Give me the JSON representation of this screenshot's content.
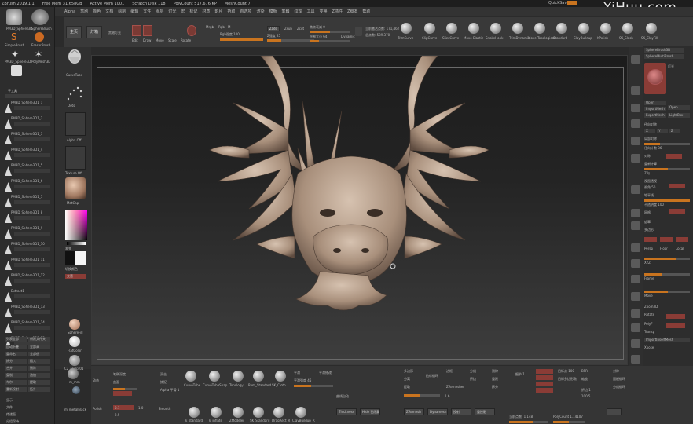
{
  "window": {
    "title_items": [
      "ZBrush 2019.1.1",
      "Free Mem 31.658GB",
      "Active Mem 1001",
      "Scratch Disk 118",
      "PolyCount 517.676 KP",
      "MeshCount 7"
    ],
    "quicksave": "QuickSave",
    "watermark": "YiHuu.com"
  },
  "menu": [
    "Alpha",
    "笔刷",
    "颜色",
    "文档",
    "绘制",
    "编辑",
    "文件",
    "图层",
    "灯光",
    "宏",
    "标记",
    "材质",
    "影片",
    "拾取",
    "首选项",
    "渲染",
    "模板",
    "笔触",
    "纹理",
    "工具",
    "变换",
    "Z插件",
    "Z脚本",
    "帮助"
  ],
  "shelf": {
    "home": "主页",
    "lightbox": "灯箱",
    "preview": "黑暗灯光",
    "edit": "Edit",
    "draw": "Draw",
    "move": "Move",
    "scale": "Scale",
    "rotate": "Rotate",
    "mrgb": "Mrgb",
    "rgb": "Rgb",
    "m": "M",
    "zadd": "Zadd",
    "zsub": "Zsub",
    "zcut": "Zcut",
    "rgb_intensity": "Rgb强度 100",
    "z_intensity": "Z强度 25",
    "focal_shift": "焦点衰减 0",
    "draw_size": "绘制大小 64",
    "dynamic": "Dynamic",
    "active_points": "当前激活点数: 171,462",
    "total_points": "总点数: 589,370",
    "brushes": [
      "TrimCurve",
      "ClipCurve",
      "SliceCurve",
      "Move Elastic",
      "SnakeHook",
      "TrimDynamic",
      "Move Topological",
      "Standard",
      "ClayBuildup",
      "hPolish",
      "SK_Slash",
      "SK_ClayFill"
    ]
  },
  "left_palette": {
    "top_brushes": [
      "PM3D_Sphere3D",
      "SphereBrush",
      "SimpleBrush",
      "EraserBrush",
      "PM3D_Sphere3D",
      "PolyMesh3D"
    ],
    "subtool_header": "子工具",
    "subtools": [
      "PM3D_Sphere3D1_1",
      "PM3D_Sphere3D1_2",
      "PM3D_Sphere3D1_3",
      "PM3D_Sphere3D1_4",
      "PM3D_Sphere3D1_5",
      "PM3D_Sphere3D1_6",
      "PM3D_Sphere3D1_7",
      "PM3D_Sphere3D1_8",
      "PM3D_Sphere3D1_9",
      "PM3D_Sphere3D1_10",
      "PM3D_Sphere3D1_11",
      "PM3D_Sphere3D1_12",
      "Extract1",
      "PM3D_Sphere3D1_13",
      "PM3D_Sphere3D1_14",
      "PM3D_Sphere3D1_15"
    ],
    "bottom_buttons": [
      "列表全部",
      "新建文件夹",
      "自动折叠",
      "全部高",
      "重命名",
      "全部低",
      "拆分",
      "插入",
      "合并",
      "删除",
      "复制",
      "追加",
      "布尔",
      "提取",
      "重新投射",
      "拓扑"
    ],
    "sub_bottom": [
      "显示",
      "文件",
      "传递面",
      "分组保持"
    ]
  },
  "left_col2": {
    "curve_tube": "CurveTube",
    "dots": "Dots",
    "alpha_off": "Alpha Off",
    "texture_off": "Texture Off",
    "matcap": "MatCap",
    "gradient": "渐变",
    "switch_color": "切换颜色",
    "alternate": "交替",
    "sphere_fill": "SphereFill",
    "flat_color": "FlatColor",
    "c2_sculpt": "C2_sculpt01",
    "mh_mm": "m_mm",
    "mm_metal": "m_metalblack"
  },
  "right_palette": {
    "tabs": [
      "SphereBrush3D",
      "SphereMultiBrush"
    ],
    "sections": [
      "灯光",
      "影子",
      "Ambient",
      "LightCap",
      "预设",
      "颜色",
      "位置",
      "强度",
      "背景",
      "渲染"
    ],
    "labels": [
      "Open",
      "LightBox",
      "径向对称",
      "X",
      "Y",
      "Z",
      "局部对称",
      "径向计数 36",
      "对称",
      "重新计算",
      "Z向",
      "视图透视",
      "视角 50",
      "地平线",
      "不透明度 100",
      "网格",
      "遮罩",
      "多边形",
      "Persp",
      "Floor",
      "Local",
      "XYZ",
      "Frame",
      "Move",
      "Zoom3D",
      "Rotate",
      "PolyF",
      "Transp",
      "Solo",
      "Xpose"
    ],
    "buttons": [
      "Open",
      "ImportMesh",
      "ExportMesh"
    ],
    "bottom_label": "ImportInsertMesh"
  },
  "bottom": {
    "brush_name": "CurveTube",
    "snap": "CurveTubeSnap",
    "topology": "Topology",
    "standard": "Rom_Standard",
    "sk_cloth": "SK_Cloth",
    "labels": [
      "动态",
      "笔刷深度",
      "曲面",
      "双击",
      "捕捉",
      "动态细分",
      "Alpha 平滑 1",
      "平滑",
      "平滑修改",
      "曲线自动",
      "多边形",
      "分离",
      "提取",
      "平滑强度 45",
      "边缘循环",
      "边框",
      "ZRemesher",
      "分组",
      "折边",
      "删除",
      "重建",
      "拆分",
      "细节 1",
      "目标点 100",
      "目标多边形数",
      "BPR",
      "缩放",
      "对称",
      "面板循环",
      "分组循环",
      "Polish",
      "Smooth"
    ],
    "brushes2": [
      "k_standard",
      "k_inflate",
      "ZModeler",
      "SK_Standard",
      "DragRect_R",
      "ClayBuildup_R"
    ],
    "buttons": [
      "Thickness",
      "Hide 已隐藏",
      "ZRemesh",
      "Dynamesh",
      "投射",
      "重投影"
    ],
    "value_a": "0.1",
    "value_b": "1.0",
    "value_c": "2.5",
    "polycount_left": "当前点数: 1.148",
    "polycount_right": "PolyCount 1.14107",
    "zoom_value": "折边 1",
    "xyz_value": "100.5",
    "mid_value": "1.6"
  },
  "colors": {
    "accent": "#c9741f",
    "red_btn": "#8a3c36",
    "panel": "#2d2d2d",
    "clay": "#b39a86"
  }
}
